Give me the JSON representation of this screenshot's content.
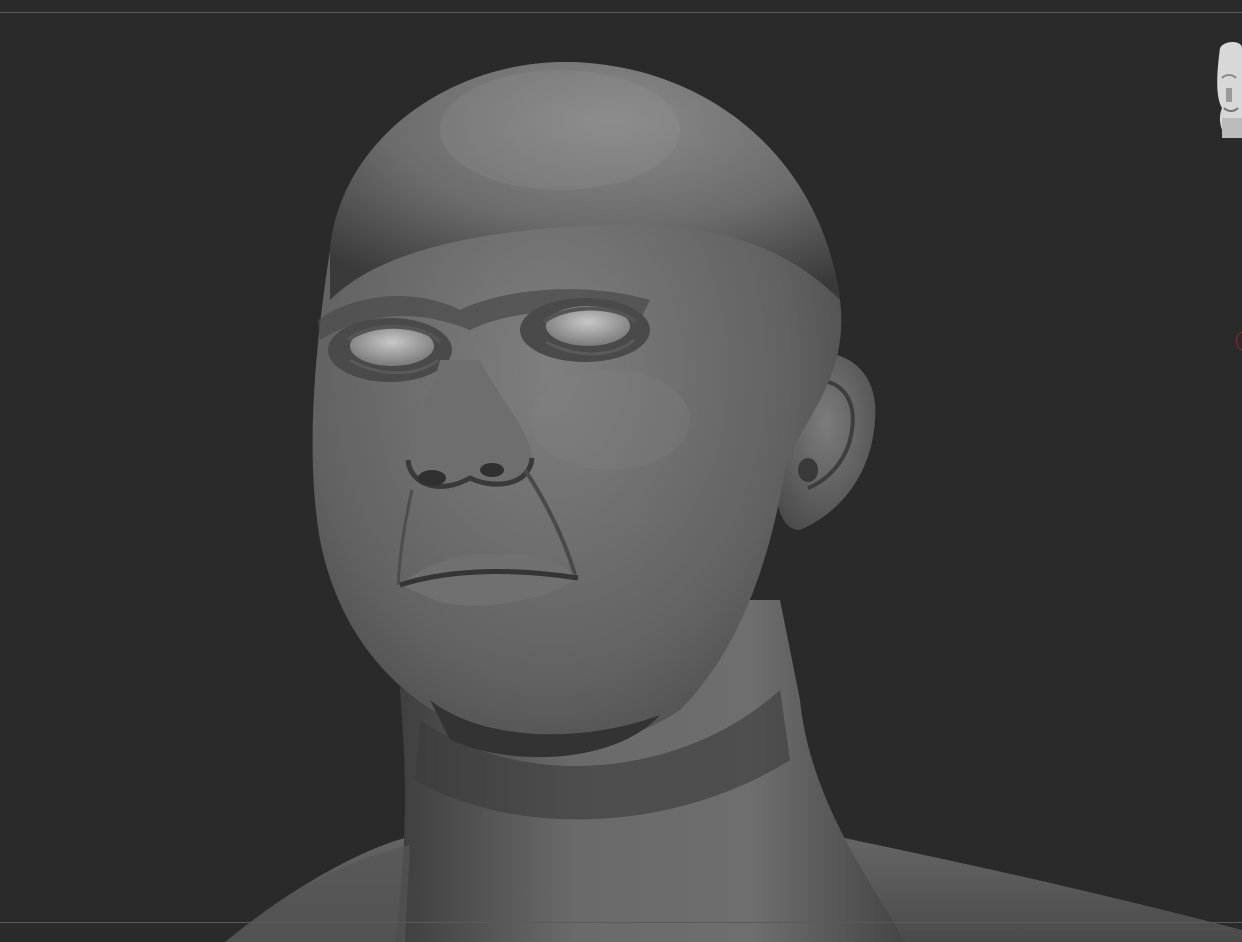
{
  "viewport": {
    "background_color": "#2a2a2a",
    "border_color": "#5a5a5a",
    "material_color": "#7a7a7a",
    "model": "male-head-bust-sculpt"
  },
  "navigator": {
    "icon": "head-orientation-navigator-icon"
  },
  "indicator": {
    "icon": "rotation-axis-indicator-icon",
    "color": "#8a2a2a"
  }
}
